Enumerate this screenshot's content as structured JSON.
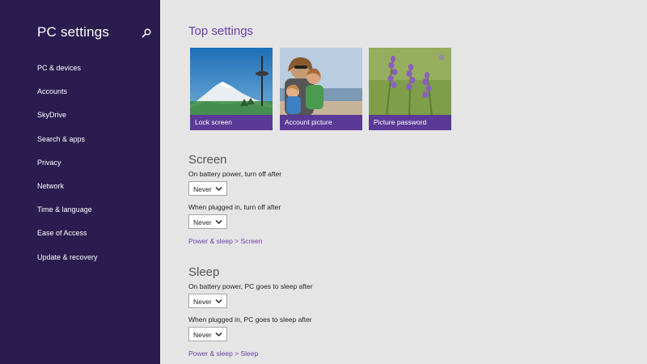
{
  "sidebar": {
    "title": "PC settings",
    "search_icon": "search-icon",
    "items": [
      {
        "label": "PC & devices"
      },
      {
        "label": "Accounts"
      },
      {
        "label": "SkyDrive"
      },
      {
        "label": "Search & apps"
      },
      {
        "label": "Privacy"
      },
      {
        "label": "Network"
      },
      {
        "label": "Time & language"
      },
      {
        "label": "Ease of Access"
      },
      {
        "label": "Update & recovery"
      }
    ]
  },
  "main": {
    "top_heading": "Top settings",
    "tiles": [
      {
        "label": "Lock screen"
      },
      {
        "label": "Account picture"
      },
      {
        "label": "Picture password"
      }
    ],
    "screen": {
      "heading": "Screen",
      "battery_label": "On battery power, turn off after",
      "battery_value": "Never",
      "plugged_label": "When plugged in, turn off after",
      "plugged_value": "Never",
      "link": "Power & sleep > Screen"
    },
    "sleep": {
      "heading": "Sleep",
      "battery_label": "On battery power, PC goes to sleep after",
      "battery_value": "Never",
      "plugged_label": "When plugged in, PC goes to sleep after",
      "plugged_value": "Never",
      "link": "Power & sleep > Sleep"
    }
  },
  "colors": {
    "sidebar_bg": "#2a1c4f",
    "accent": "#6b3fa8",
    "tile_label_bg": "#5b3a97",
    "main_bg": "#e5e5e5"
  }
}
